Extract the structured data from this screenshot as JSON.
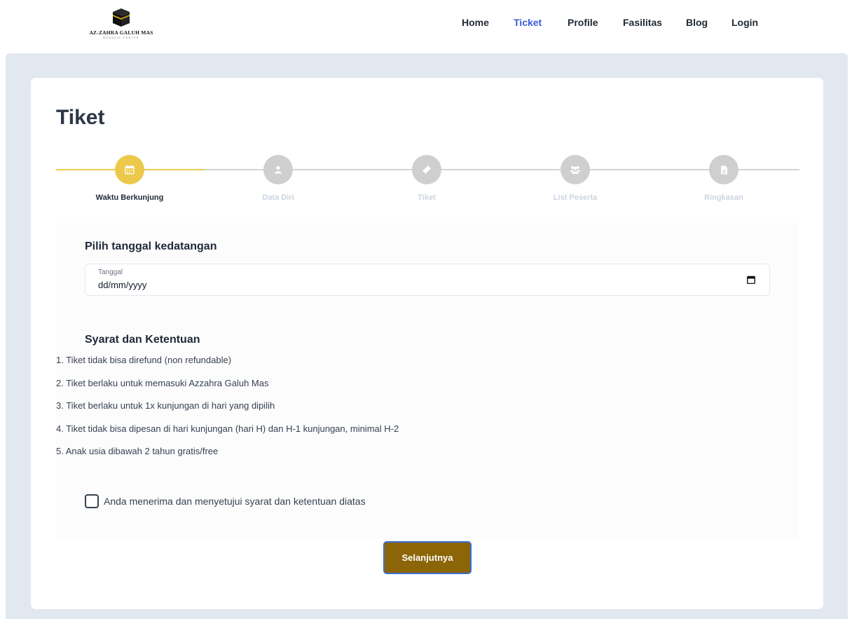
{
  "brand": {
    "name": "AZ-ZAHRA GALUH MAS",
    "tagline": "MANASIK CENTER"
  },
  "nav": {
    "items": [
      {
        "label": "Home",
        "active": false
      },
      {
        "label": "Ticket",
        "active": true
      },
      {
        "label": "Profile",
        "active": false
      },
      {
        "label": "Fasilitas",
        "active": false
      },
      {
        "label": "Blog",
        "active": false
      },
      {
        "label": "Login",
        "active": false
      }
    ]
  },
  "page": {
    "title": "Tiket"
  },
  "stepper": {
    "steps": [
      {
        "label": "Waktu Berkunjung",
        "icon": "calendar-icon",
        "active": true
      },
      {
        "label": "Data Diri",
        "icon": "user-icon",
        "active": false
      },
      {
        "label": "Tiket",
        "icon": "ticket-icon",
        "active": false
      },
      {
        "label": "List Peserta",
        "icon": "users-icon",
        "active": false
      },
      {
        "label": "Ringkasan",
        "icon": "document-icon",
        "active": false
      }
    ]
  },
  "form": {
    "date_heading": "Pilih tanggal kedatangan",
    "date_label": "Tanggal",
    "date_value": "dd/mm/yyyy",
    "terms_heading": "Syarat dan Ketentuan",
    "terms": [
      "1. Tiket tidak bisa direfund (non refundable)",
      "2. Tiket berlaku untuk memasuki Azzahra Galuh Mas",
      "3. Tiket berlaku untuk 1x kunjungan di hari yang dipilih",
      "4. Tiket tidak bisa dipesan di hari kunjungan (hari H) dan H-1 kunjungan, minimal H-2",
      "5. Anak usia dibawah 2 tahun gratis/free"
    ],
    "agree_label": "Anda menerima dan menyetujui syarat dan ketentuan diatas",
    "agree_checked": false,
    "next_button": "Selanjutnya"
  },
  "colors": {
    "accent_gold": "#ecc94b",
    "button_brown": "#8b6508",
    "nav_active": "#3b5bdb",
    "page_background": "#e2e8f0"
  }
}
